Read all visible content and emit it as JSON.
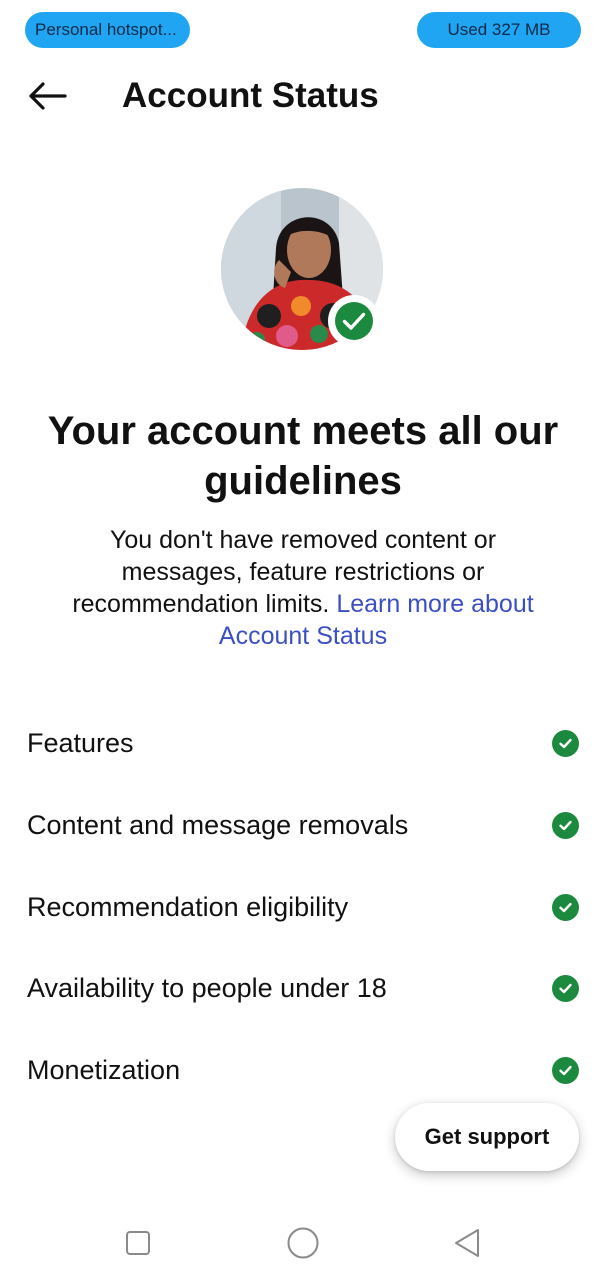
{
  "status_bar": {
    "hotspot_label": "Personal hotspot...",
    "data_usage": "Used  327 MB"
  },
  "header": {
    "title": "Account Status"
  },
  "main": {
    "headline": "Your account meets all our guidelines",
    "description": "You don't have removed content or messages, feature restrictions or recommendation limits.",
    "learn_more_link": "Learn more about Account Status"
  },
  "status_items": [
    {
      "label": "Features"
    },
    {
      "label": "Content and message removals"
    },
    {
      "label": "Recommendation eligibility"
    },
    {
      "label": "Availability to people under 18"
    },
    {
      "label": "Monetization"
    }
  ],
  "support_button": "Get support",
  "colors": {
    "accent_link": "#3b4fc4",
    "success_green": "#1c8a3e",
    "pill_blue": "#1fa5f2"
  },
  "icons": {
    "back": "arrow-left-icon",
    "verified": "check-circle-icon",
    "nav_recents": "square-icon",
    "nav_home": "circle-icon",
    "nav_back": "triangle-back-icon"
  }
}
